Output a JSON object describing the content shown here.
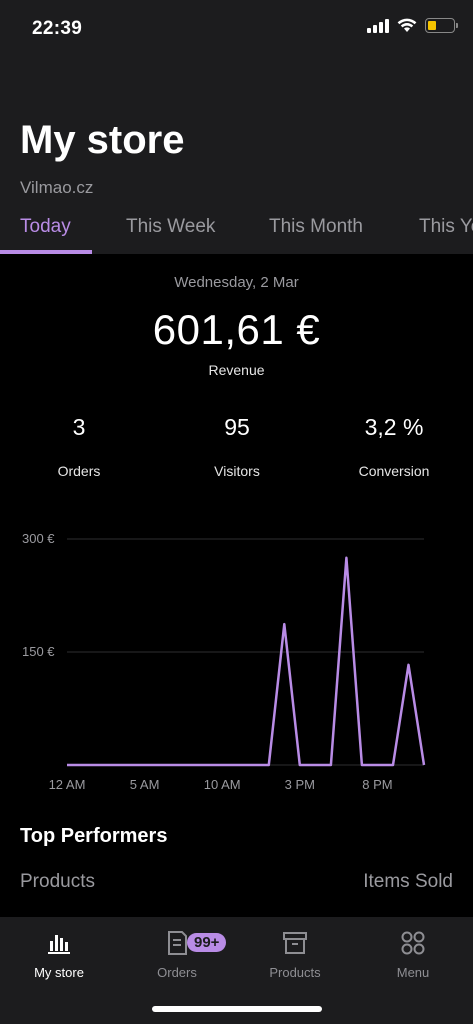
{
  "status_bar": {
    "time": "22:39"
  },
  "header": {
    "title": "My store",
    "store_name": "Vilmao.cz",
    "tabs": [
      {
        "label": "Today",
        "active": true
      },
      {
        "label": "This Week",
        "active": false
      },
      {
        "label": "This Month",
        "active": false
      },
      {
        "label": "This Year",
        "active": false
      }
    ]
  },
  "summary": {
    "date": "Wednesday, 2 Mar",
    "revenue_value": "601,61 €",
    "revenue_label": "Revenue",
    "stats": [
      {
        "value": "3",
        "label": "Orders"
      },
      {
        "value": "95",
        "label": "Visitors"
      },
      {
        "value": "3,2 %",
        "label": "Conversion"
      }
    ]
  },
  "chart_data": {
    "type": "line",
    "y_ticks": [
      "300 €",
      "150 €"
    ],
    "x_ticks": [
      "12 AM",
      "5 AM",
      "10 AM",
      "3 PM",
      "8 PM"
    ],
    "ylim": [
      0,
      300
    ],
    "series": [
      {
        "color": "#b98ce6",
        "points": [
          {
            "x": 0,
            "y": 0
          },
          {
            "x": 13,
            "y": 0
          },
          {
            "x": 14,
            "y": 187
          },
          {
            "x": 15,
            "y": 0
          },
          {
            "x": 17,
            "y": 0
          },
          {
            "x": 18,
            "y": 275
          },
          {
            "x": 19,
            "y": 0
          },
          {
            "x": 21,
            "y": 0
          },
          {
            "x": 22,
            "y": 133
          },
          {
            "x": 23,
            "y": 0
          }
        ]
      }
    ]
  },
  "top_performers": {
    "title": "Top Performers",
    "col_products": "Products",
    "col_items_sold": "Items Sold"
  },
  "tab_bar": {
    "items": [
      {
        "label": "My store",
        "icon": "bar-chart-icon",
        "active": true
      },
      {
        "label": "Orders",
        "icon": "orders-icon",
        "active": false,
        "badge": "99+"
      },
      {
        "label": "Products",
        "icon": "archive-box-icon",
        "active": false
      },
      {
        "label": "Menu",
        "icon": "grid-dots-icon",
        "active": false
      }
    ]
  },
  "colors": {
    "accent": "#b98ce6",
    "background": "#000000",
    "surface": "#1c1c1e"
  }
}
